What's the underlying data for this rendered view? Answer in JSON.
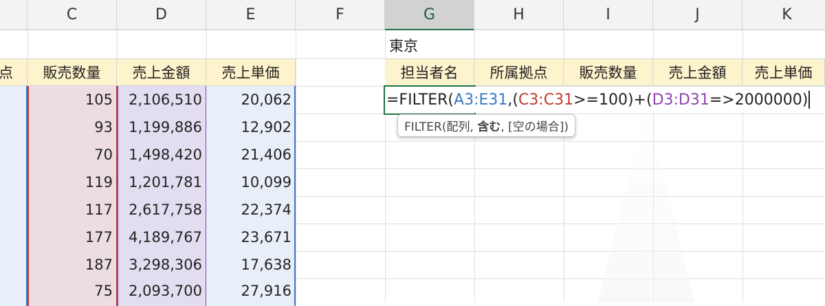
{
  "column_headers": [
    "C",
    "D",
    "E",
    "F",
    "G",
    "H",
    "I",
    "J",
    "K"
  ],
  "active_column": "G",
  "left_table": {
    "partial_header": "点",
    "headers": [
      "販売数量",
      "売上金額",
      "売上単価"
    ],
    "rows": [
      [
        "105",
        "2,106,510",
        "20,062"
      ],
      [
        "93",
        "1,199,886",
        "12,902"
      ],
      [
        "70",
        "1,498,420",
        "21,406"
      ],
      [
        "119",
        "1,201,781",
        "10,099"
      ],
      [
        "117",
        "2,617,758",
        "22,374"
      ],
      [
        "177",
        "4,189,767",
        "23,671"
      ],
      [
        "187",
        "3,298,306",
        "17,638"
      ],
      [
        "75",
        "2,093,700",
        "27,916"
      ]
    ]
  },
  "right_table": {
    "title": "東京",
    "headers": [
      "担当者名",
      "所属拠点",
      "販売数量",
      "売上金額",
      "売上単価"
    ]
  },
  "formula": {
    "segments": [
      {
        "text": "=FILTER(",
        "color": "#222222"
      },
      {
        "text": "A3:E31",
        "color": "#3a78c8"
      },
      {
        "text": ",(",
        "color": "#222222"
      },
      {
        "text": "C3:C31",
        "color": "#c0392b"
      },
      {
        "text": ">=100)+(",
        "color": "#222222"
      },
      {
        "text": "D3:D31",
        "color": "#8e44ad"
      },
      {
        "text": "=>2000000)",
        "color": "#222222"
      }
    ]
  },
  "tooltip": {
    "prefix": "FILTER(配列, ",
    "bold": "含む",
    "suffix": ", [空の場合])"
  },
  "colors": {
    "range_a": "#3a78c8",
    "range_c": "#c0392b",
    "range_d": "#8e44ad",
    "header_fill": "#fdf3cc",
    "active_border": "#1e7145"
  }
}
